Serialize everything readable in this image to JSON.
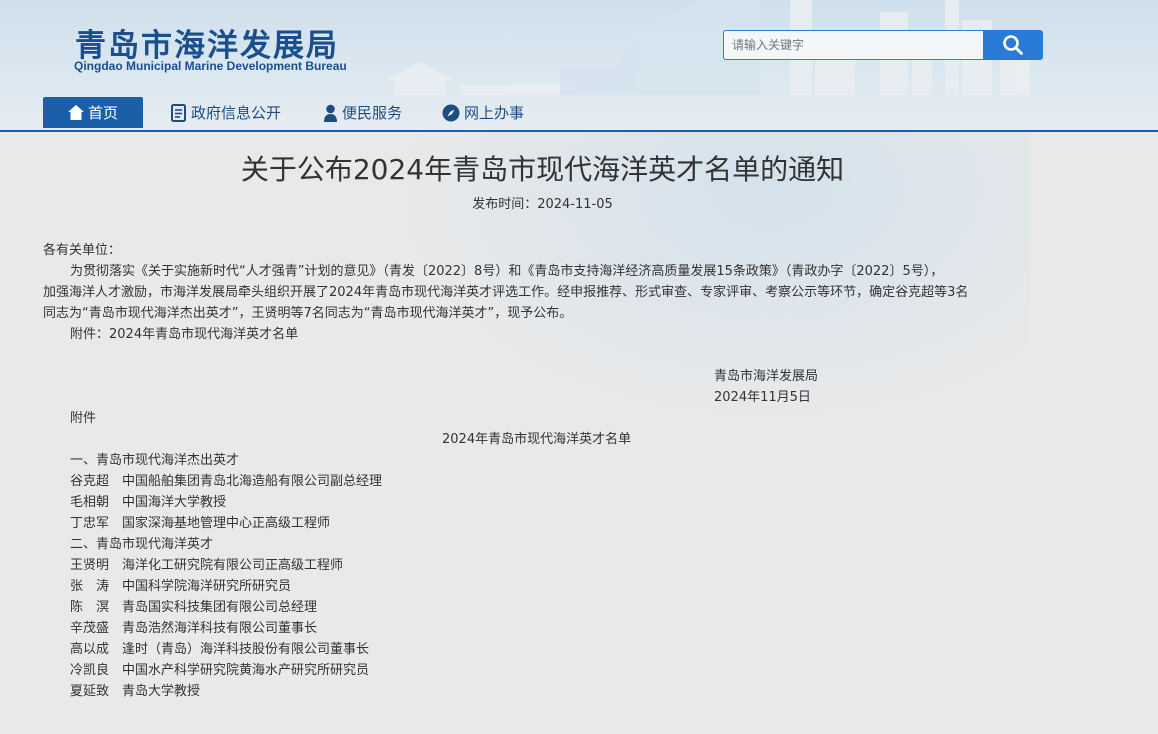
{
  "header": {
    "logo_cn": "青岛市海洋发展局",
    "logo_en": "Qingdao Municipal Marine Development Bureau",
    "search_placeholder": "请输入关键字"
  },
  "nav": {
    "items": [
      {
        "label": "首页",
        "icon": "home-icon"
      },
      {
        "label": "政府信息公开",
        "icon": "document-icon"
      },
      {
        "label": "便民服务",
        "icon": "person-icon"
      },
      {
        "label": "网上办事",
        "icon": "compass-icon"
      }
    ]
  },
  "article": {
    "title": "关于公布2024年青岛市现代海洋英才名单的通知",
    "date": "发布时间：2024-11-05",
    "salutation": "各有关单位：",
    "body_lines": [
      "为贯彻落实《关于实施新时代“人才强青”计划的意见》（青发〔2022〕8号）和《青岛市支持海洋经济高质量发展15条政策》（青政办字〔2022〕5号），",
      "加强海洋人才激励，市海洋发展局牵头组织开展了2024年青岛市现代海洋英才评选工作。经申报推荐、形式审查、专家评审、考察公示等环节，确定谷克超等3名",
      "同志为“青岛市现代海洋杰出英才”，王贤明等7名同志为“青岛市现代海洋英才”，现予公布。"
    ],
    "attachment_note": "附件：2024年青岛市现代海洋英才名单",
    "signature_org": "青岛市海洋发展局",
    "signature_date": "2024年11月5日",
    "attachment_label": "附件",
    "list_title": "2024年青岛市现代海洋英才名单",
    "section1": "一、青岛市现代海洋杰出英才",
    "section1_people": [
      "谷克超　中国船舶集团青岛北海造船有限公司副总经理",
      "毛相朝　中国海洋大学教授",
      "丁忠军　国家深海基地管理中心正高级工程师"
    ],
    "section2": "二、青岛市现代海洋英才",
    "section2_people": [
      "王贤明　海洋化工研究院有限公司正高级工程师",
      "张　涛　中国科学院海洋研究所研究员",
      "陈　溟　青岛国实科技集团有限公司总经理",
      "辛茂盛　青岛浩然海洋科技有限公司董事长",
      "高以成　逢时（青岛）海洋科技股份有限公司董事长",
      "冷凯良　中国水产科学研究院黄海水产研究所研究员",
      "夏延致　青岛大学教授"
    ]
  }
}
